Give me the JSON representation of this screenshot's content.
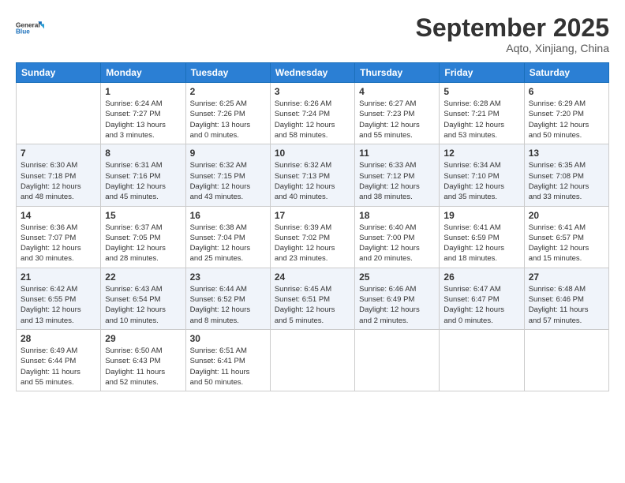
{
  "logo": {
    "line1": "General",
    "line2": "Blue"
  },
  "title": "September 2025",
  "location": "Aqto, Xinjiang, China",
  "weekdays": [
    "Sunday",
    "Monday",
    "Tuesday",
    "Wednesday",
    "Thursday",
    "Friday",
    "Saturday"
  ],
  "weeks": [
    [
      {
        "day": "",
        "info": ""
      },
      {
        "day": "1",
        "info": "Sunrise: 6:24 AM\nSunset: 7:27 PM\nDaylight: 13 hours\nand 3 minutes."
      },
      {
        "day": "2",
        "info": "Sunrise: 6:25 AM\nSunset: 7:26 PM\nDaylight: 13 hours\nand 0 minutes."
      },
      {
        "day": "3",
        "info": "Sunrise: 6:26 AM\nSunset: 7:24 PM\nDaylight: 12 hours\nand 58 minutes."
      },
      {
        "day": "4",
        "info": "Sunrise: 6:27 AM\nSunset: 7:23 PM\nDaylight: 12 hours\nand 55 minutes."
      },
      {
        "day": "5",
        "info": "Sunrise: 6:28 AM\nSunset: 7:21 PM\nDaylight: 12 hours\nand 53 minutes."
      },
      {
        "day": "6",
        "info": "Sunrise: 6:29 AM\nSunset: 7:20 PM\nDaylight: 12 hours\nand 50 minutes."
      }
    ],
    [
      {
        "day": "7",
        "info": "Sunrise: 6:30 AM\nSunset: 7:18 PM\nDaylight: 12 hours\nand 48 minutes."
      },
      {
        "day": "8",
        "info": "Sunrise: 6:31 AM\nSunset: 7:16 PM\nDaylight: 12 hours\nand 45 minutes."
      },
      {
        "day": "9",
        "info": "Sunrise: 6:32 AM\nSunset: 7:15 PM\nDaylight: 12 hours\nand 43 minutes."
      },
      {
        "day": "10",
        "info": "Sunrise: 6:32 AM\nSunset: 7:13 PM\nDaylight: 12 hours\nand 40 minutes."
      },
      {
        "day": "11",
        "info": "Sunrise: 6:33 AM\nSunset: 7:12 PM\nDaylight: 12 hours\nand 38 minutes."
      },
      {
        "day": "12",
        "info": "Sunrise: 6:34 AM\nSunset: 7:10 PM\nDaylight: 12 hours\nand 35 minutes."
      },
      {
        "day": "13",
        "info": "Sunrise: 6:35 AM\nSunset: 7:08 PM\nDaylight: 12 hours\nand 33 minutes."
      }
    ],
    [
      {
        "day": "14",
        "info": "Sunrise: 6:36 AM\nSunset: 7:07 PM\nDaylight: 12 hours\nand 30 minutes."
      },
      {
        "day": "15",
        "info": "Sunrise: 6:37 AM\nSunset: 7:05 PM\nDaylight: 12 hours\nand 28 minutes."
      },
      {
        "day": "16",
        "info": "Sunrise: 6:38 AM\nSunset: 7:04 PM\nDaylight: 12 hours\nand 25 minutes."
      },
      {
        "day": "17",
        "info": "Sunrise: 6:39 AM\nSunset: 7:02 PM\nDaylight: 12 hours\nand 23 minutes."
      },
      {
        "day": "18",
        "info": "Sunrise: 6:40 AM\nSunset: 7:00 PM\nDaylight: 12 hours\nand 20 minutes."
      },
      {
        "day": "19",
        "info": "Sunrise: 6:41 AM\nSunset: 6:59 PM\nDaylight: 12 hours\nand 18 minutes."
      },
      {
        "day": "20",
        "info": "Sunrise: 6:41 AM\nSunset: 6:57 PM\nDaylight: 12 hours\nand 15 minutes."
      }
    ],
    [
      {
        "day": "21",
        "info": "Sunrise: 6:42 AM\nSunset: 6:55 PM\nDaylight: 12 hours\nand 13 minutes."
      },
      {
        "day": "22",
        "info": "Sunrise: 6:43 AM\nSunset: 6:54 PM\nDaylight: 12 hours\nand 10 minutes."
      },
      {
        "day": "23",
        "info": "Sunrise: 6:44 AM\nSunset: 6:52 PM\nDaylight: 12 hours\nand 8 minutes."
      },
      {
        "day": "24",
        "info": "Sunrise: 6:45 AM\nSunset: 6:51 PM\nDaylight: 12 hours\nand 5 minutes."
      },
      {
        "day": "25",
        "info": "Sunrise: 6:46 AM\nSunset: 6:49 PM\nDaylight: 12 hours\nand 2 minutes."
      },
      {
        "day": "26",
        "info": "Sunrise: 6:47 AM\nSunset: 6:47 PM\nDaylight: 12 hours\nand 0 minutes."
      },
      {
        "day": "27",
        "info": "Sunrise: 6:48 AM\nSunset: 6:46 PM\nDaylight: 11 hours\nand 57 minutes."
      }
    ],
    [
      {
        "day": "28",
        "info": "Sunrise: 6:49 AM\nSunset: 6:44 PM\nDaylight: 11 hours\nand 55 minutes."
      },
      {
        "day": "29",
        "info": "Sunrise: 6:50 AM\nSunset: 6:43 PM\nDaylight: 11 hours\nand 52 minutes."
      },
      {
        "day": "30",
        "info": "Sunrise: 6:51 AM\nSunset: 6:41 PM\nDaylight: 11 hours\nand 50 minutes."
      },
      {
        "day": "",
        "info": ""
      },
      {
        "day": "",
        "info": ""
      },
      {
        "day": "",
        "info": ""
      },
      {
        "day": "",
        "info": ""
      }
    ]
  ]
}
